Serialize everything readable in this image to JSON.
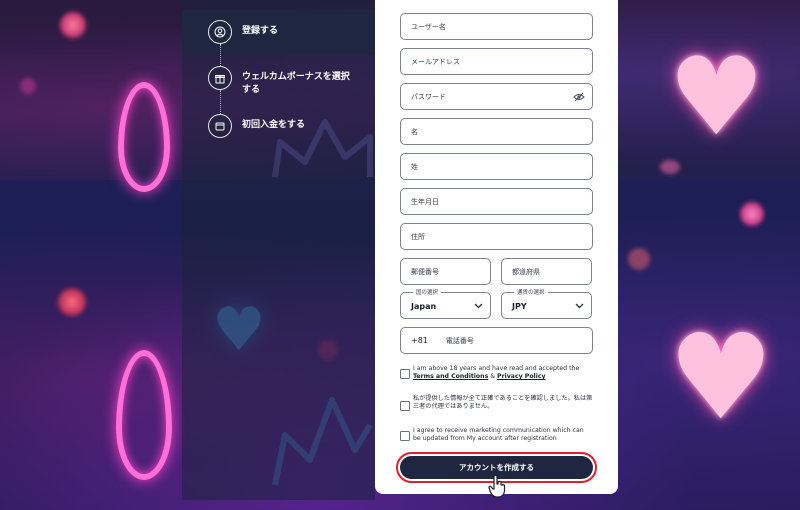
{
  "steps": [
    {
      "label": "登録する",
      "icon": "user-icon"
    },
    {
      "label": "ウェルカムボーナスを選択する",
      "icon": "gift-icon"
    },
    {
      "label": "初回入金をする",
      "icon": "wallet-icon"
    }
  ],
  "form": {
    "username_placeholder": "ユーザー名",
    "email_placeholder": "メールアドレス",
    "password_placeholder": "パスワード",
    "firstname_placeholder": "名",
    "lastname_placeholder": "姓",
    "dob_placeholder": "生年月日",
    "address_placeholder": "住所",
    "postal_placeholder": "郵便番号",
    "prefecture_placeholder": "都道府県",
    "country": {
      "legend": "国の選択",
      "value": "Japan"
    },
    "currency": {
      "legend": "通貨の選択",
      "value": "JPY"
    },
    "phone": {
      "prefix": "+81",
      "placeholder": "電話番号"
    }
  },
  "checkboxes": {
    "age": {
      "text": "I am above 18 years and have read and accepted the",
      "terms_link": "Terms and Conditions",
      "amp": "&",
      "privacy_link": "Privacy Policy"
    },
    "accuracy": {
      "text": "私が提供した情報が全て正確であることを確認しました。私は第三者の代理ではありません。"
    },
    "marketing": {
      "text": "I agree to receive marketing communication which can be updated from My account after registration"
    }
  },
  "create_button": "アカウントを作成する",
  "colors": {
    "accent_navy": "#1f2740",
    "highlight_ring": "#e0202a",
    "neon_pink": "#ff6fd8"
  }
}
